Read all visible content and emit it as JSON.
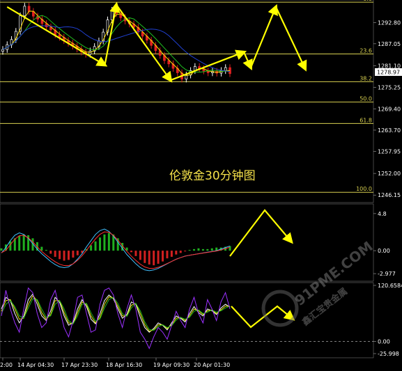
{
  "chart_data": {
    "type": "line",
    "title": "伦敦金30分钟图",
    "instrument": "London Gold",
    "timeframe": "30 minutes",
    "current_price": "1278.97",
    "price_axis": {
      "ticks": [
        "1292.80",
        "1287.05",
        "1281.10",
        "1275.25",
        "1269.40",
        "1263.70",
        "1257.95",
        "1252.00",
        "1246.15"
      ],
      "range": [
        1244.5,
        1298.5
      ]
    },
    "fibonacci_levels": [
      {
        "label": "0.0",
        "price": 1298.3
      },
      {
        "label": "23.6",
        "price": 1284.3
      },
      {
        "label": "38.2",
        "price": 1276.8
      },
      {
        "label": "50.0",
        "price": 1271.3
      },
      {
        "label": "61.8",
        "price": 1265.5
      },
      {
        "label": "100.0",
        "price": 1246.9
      }
    ],
    "time_axis": {
      "ticks": [
        "2:00",
        "14 Apr 04:30",
        "17 Apr 23:30",
        "18 Apr 16:30",
        "19 Apr 09:30",
        "20 Apr 01:30"
      ]
    },
    "price_series": {
      "name": "price",
      "values": [
        1285.5,
        1286.8,
        1288.2,
        1290.4,
        1294.6,
        1297.2,
        1295.8,
        1294.5,
        1293.7,
        1292.5,
        1291.6,
        1290.8,
        1289.5,
        1288.8,
        1287.9,
        1287.2,
        1286.4,
        1285.6,
        1284.8,
        1284.2,
        1285.1,
        1286.3,
        1287.8,
        1290.2,
        1293.5,
        1296.1,
        1295.2,
        1294.1,
        1293.2,
        1292.4,
        1291.5,
        1290.2,
        1289.1,
        1288.0,
        1286.6,
        1285.2,
        1283.9,
        1282.5,
        1281.6,
        1280.4,
        1279.2,
        1277.5,
        1278.6,
        1279.8,
        1280.9,
        1280.3,
        1279.7,
        1279.2,
        1279.6,
        1279.1,
        1279.8,
        1280.6,
        1278.97
      ]
    },
    "macd_panel": {
      "ticks": [
        "4.8",
        "0.00",
        "-2.977"
      ],
      "range": [
        -3.6,
        5.6
      ],
      "histogram": [
        0.3,
        0.8,
        1.2,
        1.6,
        1.9,
        2.1,
        2.0,
        1.6,
        1.1,
        0.5,
        0.1,
        -0.4,
        -0.8,
        -1.1,
        -1.3,
        -1.2,
        -0.9,
        -0.6,
        -0.3,
        0.2,
        0.7,
        1.2,
        1.7,
        2.1,
        2.3,
        2.1,
        1.6,
        1.0,
        0.4,
        -0.2,
        -0.7,
        -1.2,
        -1.6,
        -1.8,
        -1.9,
        -1.7,
        -1.4,
        -1.0,
        -0.8,
        -0.5,
        -0.3,
        -0.1,
        0.1,
        0.2,
        0.3,
        0.2,
        0.2,
        0.3,
        0.4,
        0.4,
        0.5,
        0.6
      ],
      "signal": [
        -0.3,
        0.4,
        1.3,
        2.0,
        2.3,
        2.1,
        1.6,
        0.9,
        0.2,
        -0.4,
        -0.9,
        -1.4,
        -1.8,
        -2.1,
        -2.2,
        -2.1,
        -1.7,
        -1.1,
        -0.4,
        0.5,
        1.3,
        2.1,
        2.6,
        2.8,
        2.5,
        1.9,
        1.1,
        0.3,
        -0.5,
        -1.1,
        -1.7,
        -2.2,
        -2.5,
        -2.6,
        -2.5,
        -2.3,
        -2.0,
        -1.7,
        -1.4,
        -1.1,
        -0.9,
        -0.7,
        -0.6,
        -0.5,
        -0.4,
        -0.3,
        -0.2,
        -0.1,
        0.0,
        0.2,
        0.4,
        0.6
      ]
    },
    "oscillator_panel": {
      "ticks": [
        "120.6584",
        "0.00",
        "-25.998"
      ],
      "range": [
        -25.998,
        120.6584
      ],
      "series": [
        {
          "color": "#ffffff",
          "values": [
            70,
            95,
            88,
            60,
            40,
            55,
            90,
            102,
            80,
            55,
            45,
            66,
            95,
            84,
            55,
            35,
            40,
            70,
            90,
            75,
            48,
            38,
            60,
            88,
            100,
            92,
            70,
            50,
            58,
            85,
            80,
            52,
            30,
            20,
            28,
            40,
            35,
            25,
            40,
            55,
            50,
            42,
            60,
            75,
            62,
            55,
            70,
            66,
            58,
            72,
            80,
            74
          ]
        },
        {
          "color": "#e8e800",
          "values": [
            65,
            88,
            90,
            70,
            48,
            50,
            80,
            98,
            88,
            62,
            48,
            58,
            88,
            88,
            62,
            40,
            38,
            62,
            85,
            80,
            55,
            40,
            52,
            80,
            96,
            94,
            76,
            55,
            55,
            78,
            82,
            60,
            36,
            22,
            25,
            36,
            36,
            28,
            36,
            50,
            52,
            45,
            55,
            70,
            66,
            58,
            66,
            68,
            60,
            68,
            76,
            76
          ]
        },
        {
          "color": "#20b020",
          "values": [
            60,
            80,
            88,
            75,
            55,
            50,
            72,
            92,
            90,
            70,
            52,
            55,
            80,
            88,
            70,
            45,
            38,
            55,
            80,
            82,
            62,
            44,
            48,
            72,
            90,
            95,
            82,
            60,
            54,
            72,
            82,
            66,
            42,
            26,
            24,
            32,
            36,
            30,
            34,
            46,
            52,
            48,
            52,
            65,
            68,
            60,
            63,
            68,
            63,
            66,
            72,
            76
          ]
        },
        {
          "color": "#9b30ff",
          "values": [
            55,
            110,
            70,
            40,
            20,
            70,
            115,
            105,
            60,
            30,
            40,
            90,
            110,
            70,
            30,
            10,
            45,
            95,
            100,
            60,
            20,
            25,
            80,
            110,
            115,
            100,
            60,
            30,
            70,
            100,
            70,
            20,
            5,
            -15,
            10,
            30,
            20,
            5,
            35,
            65,
            45,
            30,
            70,
            95,
            60,
            40,
            90,
            70,
            45,
            85,
            105,
            70
          ]
        }
      ]
    },
    "projection_arrows": [
      {
        "from": [
          1279.5,
          46
        ],
        "to": [
          1284.8,
          50
        ]
      },
      {
        "from": [
          1284.8,
          50
        ],
        "to": [
          1281.0,
          53
        ]
      },
      {
        "from": [
          1281.0,
          53
        ],
        "to": [
          1297.0,
          58
        ]
      },
      {
        "from": [
          1297.0,
          58
        ],
        "to": [
          1280.3,
          63
        ]
      }
    ],
    "watermark": "91PME.COM 鑫汇宝贵金属"
  }
}
